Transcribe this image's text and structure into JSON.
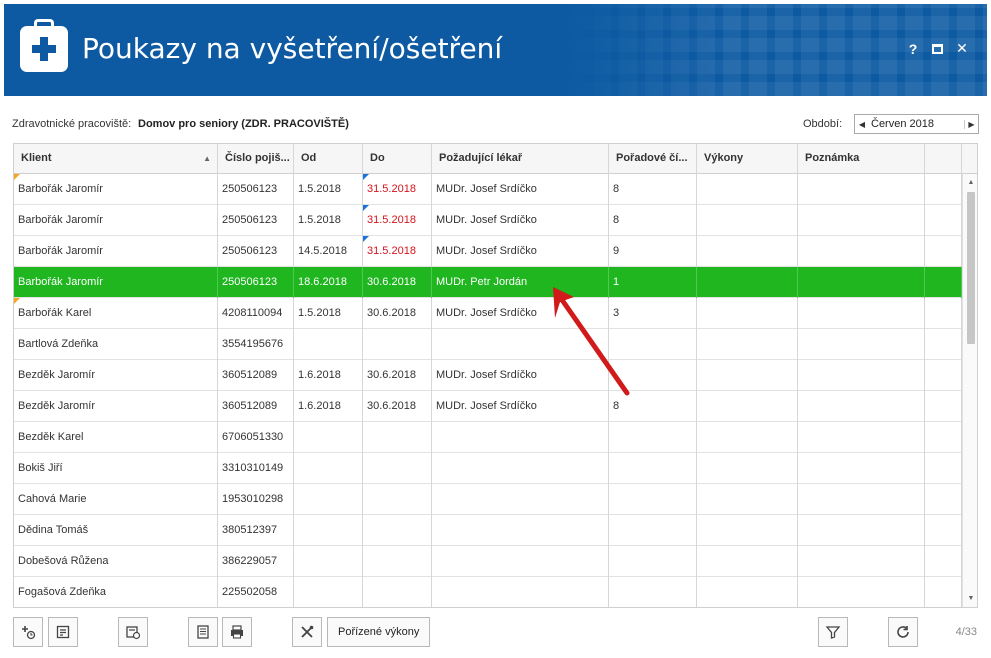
{
  "window": {
    "title": "Poukazy na vyšetření/ošetření",
    "help": "?",
    "close": "✕"
  },
  "filter": {
    "workspace_label": "Zdravotnické pracoviště:",
    "workspace_value": "Domov pro seniory (ZDR. PRACOVIŠTĚ)",
    "period_label": "Období:",
    "period_value": "Červen 2018",
    "period_prev": "◀",
    "period_next": "▶"
  },
  "grid": {
    "headers": [
      "Klient",
      "Číslo pojiš...",
      "Od",
      "Do",
      "Požadující lékař",
      "Pořadové čí...",
      "Výkony",
      "Poznámka"
    ],
    "sort_indicator": "▲",
    "rows": [
      {
        "klient": "Barbořák Jaromír",
        "cislo": "250506123",
        "od": "1.5.2018",
        "do": "31.5.2018",
        "lekar": "MUDr. Josef Srdíčko",
        "poradove": "8",
        "vykony": "",
        "poznamka": ""
      },
      {
        "klient": "Barbořák Jaromír",
        "cislo": "250506123",
        "od": "1.5.2018",
        "do": "31.5.2018",
        "lekar": "MUDr. Josef Srdíčko",
        "poradove": "8",
        "vykony": "",
        "poznamka": ""
      },
      {
        "klient": "Barbořák Jaromír",
        "cislo": "250506123",
        "od": "14.5.2018",
        "do": "31.5.2018",
        "lekar": "MUDr. Josef Srdíčko",
        "poradove": "9",
        "vykony": "",
        "poznamka": ""
      },
      {
        "klient": "Barbořák Jaromír",
        "cislo": "250506123",
        "od": "18.6.2018",
        "do": "30.6.2018",
        "lekar": "MUDr. Petr Jordán",
        "poradove": "1",
        "vykony": "",
        "poznamka": ""
      },
      {
        "klient": "Barbořák Karel",
        "cislo": "4208110094",
        "od": "1.5.2018",
        "do": "30.6.2018",
        "lekar": "MUDr. Josef Srdíčko",
        "poradove": "3",
        "vykony": "",
        "poznamka": ""
      },
      {
        "klient": "Bartlová Zdeňka",
        "cislo": "3554195676",
        "od": "",
        "do": "",
        "lekar": "",
        "poradove": "",
        "vykony": "",
        "poznamka": ""
      },
      {
        "klient": "Bezděk Jaromír",
        "cislo": "360512089",
        "od": "1.6.2018",
        "do": "30.6.2018",
        "lekar": "MUDr. Josef Srdíčko",
        "poradove": "",
        "vykony": "",
        "poznamka": ""
      },
      {
        "klient": "Bezděk Jaromír",
        "cislo": "360512089",
        "od": "1.6.2018",
        "do": "30.6.2018",
        "lekar": "MUDr. Josef Srdíčko",
        "poradove": "8",
        "vykony": "",
        "poznamka": ""
      },
      {
        "klient": "Bezděk Karel",
        "cislo": "6706051330",
        "od": "",
        "do": "",
        "lekar": "",
        "poradove": "",
        "vykony": "",
        "poznamka": ""
      },
      {
        "klient": "Bokiš Jiří",
        "cislo": "3310310149",
        "od": "",
        "do": "",
        "lekar": "",
        "poradove": "",
        "vykony": "",
        "poznamka": ""
      },
      {
        "klient": "Cahová Marie",
        "cislo": "1953010298",
        "od": "",
        "do": "",
        "lekar": "",
        "poradove": "",
        "vykony": "",
        "poznamka": ""
      },
      {
        "klient": "Dědina Tomáš",
        "cislo": "380512397",
        "od": "",
        "do": "",
        "lekar": "",
        "poradove": "",
        "vykony": "",
        "poznamka": ""
      },
      {
        "klient": "Dobešová Růžena",
        "cislo": "386229057",
        "od": "",
        "do": "",
        "lekar": "",
        "poradove": "",
        "vykony": "",
        "poznamka": ""
      },
      {
        "klient": "Fogašová Zdeňka",
        "cislo": "225502058",
        "od": "",
        "do": "",
        "lekar": "",
        "poradove": "",
        "vykony": "",
        "poznamka": ""
      }
    ],
    "selected_row": 3,
    "red_do_rows": [
      0,
      1,
      2
    ],
    "orange_marker_rows": [
      0,
      4
    ],
    "blue_marker_do_rows": [
      0,
      1,
      2
    ],
    "scroll_up": "▲",
    "scroll_down": "▼"
  },
  "toolbar": {
    "vykony_button_label": "Pořízené výkony",
    "page_count": "4/33"
  },
  "colors": {
    "titlebar": "#0d5aa3",
    "selected_row": "#1fb61f",
    "red_text": "#d4141c",
    "annotation_arrow": "#d11a1a"
  },
  "icons": [
    "medical-kit-icon",
    "help-icon",
    "maximize-icon",
    "close-icon",
    "add-timer-icon",
    "edit-note-icon",
    "calendar-clock-icon",
    "document-icon",
    "print-icon",
    "tools-icon",
    "filter-icon",
    "refresh-icon"
  ]
}
